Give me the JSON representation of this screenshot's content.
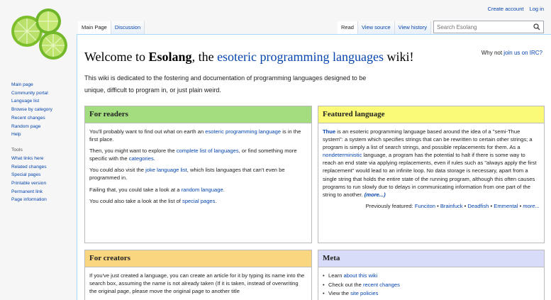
{
  "personal": {
    "create_account": "Create account",
    "log_in": "Log in"
  },
  "tabs": {
    "main_page": "Main Page",
    "discussion": "Discussion",
    "read": "Read",
    "view_source": "View source",
    "view_history": "View history"
  },
  "search": {
    "placeholder": "Search Esolang"
  },
  "sidebar": {
    "nav": [
      "Main page",
      "Community portal",
      "Language list",
      "Browse by category",
      "Recent changes",
      "Random page",
      "Help"
    ],
    "tools_heading": "Tools",
    "tools": [
      "What links here",
      "Related changes",
      "Special pages",
      "Printable version",
      "Permanent link",
      "Page information"
    ]
  },
  "main": {
    "title_pre": "Welcome to ",
    "title_name": "Esolang",
    "title_mid": ", the ",
    "title_link": "esoteric programming languages",
    "title_post": " wiki!",
    "irc_pre": "Why not ",
    "irc_link": "join us on IRC?",
    "intro": "This wiki is dedicated to the fostering and documentation of programming languages designed to be unique, difficult to program in, or just plain weird."
  },
  "readers": {
    "heading": "For readers",
    "p1_pre": "You'll probably want to find out what on earth an ",
    "p1_link": "esoteric programming language",
    "p1_post": " is in the first place.",
    "p2_pre": "Then, you might want to explore the ",
    "p2_link": "complete list of languages",
    "p2_mid": ", or find something more specific with the ",
    "p2_link2": "categories",
    "p2_post": ".",
    "p3_pre": "You could also visit the ",
    "p3_link": "joke language list",
    "p3_post": ", which lists languages that can't even be programmed in.",
    "p4_pre": "Failing that, you could take a look at a ",
    "p4_link": "random language",
    "p4_post": ".",
    "p5_pre": "You could also take a look at the list of ",
    "p5_link": "special pages",
    "p5_post": "."
  },
  "featured": {
    "heading": "Featured language",
    "name": "Thue",
    "t1": " is an esoteric programming language based around the idea of a \"semi-Thue system\": a system which specifies strings that can be rewritten to certain other strings; a program is simply a list of search strings, and possible replacements for them. As a ",
    "link": "nondeterministic",
    "t2": " language, a program has the potential to halt if there is some way to reach an end state via applying replacements, even if rules such as \"always apply the first replacement\" would lead to an infinite loop. No data storage is necessary, apart from a single string that holds the entire state of the running program, although this often causes programs to run slowly due to delays in communicating information from one part of the string to another. ",
    "more": "(more...)",
    "prev_label": "Previously featured: ",
    "prev": [
      "Funciton",
      "Brainfuck",
      "Deadfish",
      "Emmental"
    ],
    "sep": " • ",
    "prev_more": "more..."
  },
  "creators": {
    "heading": "For creators",
    "text": "If you've just created a language, you can create an article for it by typing its name into the search box, assuming the name is not already taken (If it is taken, instead of overwriting the original page, please move the original page to another title"
  },
  "meta": {
    "heading": "Meta",
    "i1_pre": "Learn ",
    "i1_link": "about this wiki",
    "i2_pre": "Check out the ",
    "i2_link": "recent changes",
    "i3_pre": "View the ",
    "i3_link": "site policies"
  },
  "colors": {
    "readers": "#a3dd80",
    "featured": "#fafa78",
    "creators": "#fad680",
    "meta": "#d8dcf8",
    "link": "#0645ad"
  }
}
